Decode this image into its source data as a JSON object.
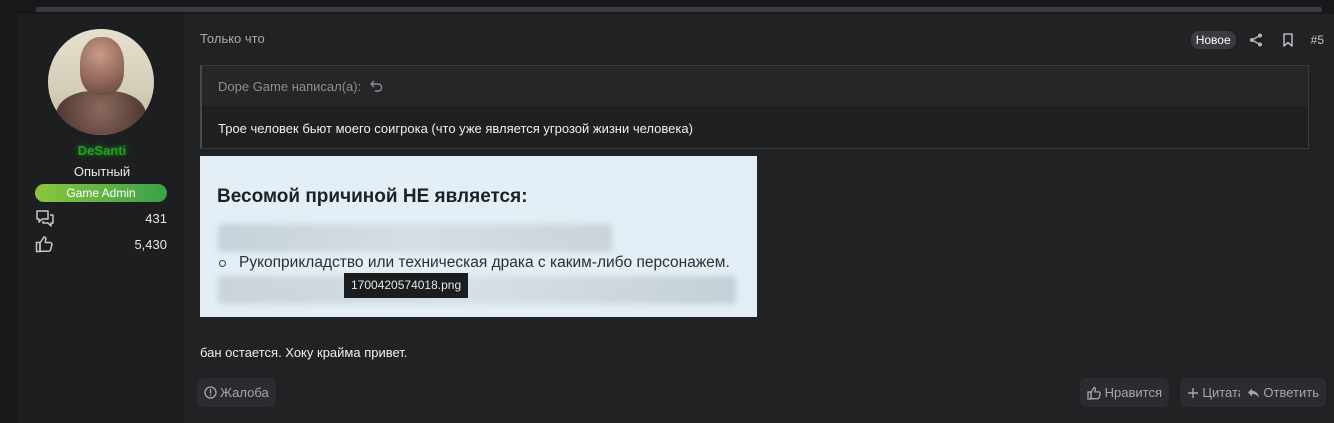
{
  "user": {
    "name": "DeSanti",
    "title": "Опытный",
    "banner": "Game Admin",
    "stats": [
      {
        "icon": "messages-icon",
        "value": "431"
      },
      {
        "icon": "reactions-thumbs-up-icon",
        "value": "5,430"
      }
    ]
  },
  "post": {
    "timestamp": "Только что",
    "new_badge": "Новое",
    "number": "#5",
    "quote": {
      "author": "Dope Game написал(а):",
      "text": "Трое человек бьют моего соигрока (что уже является угрозой жизни человека)"
    },
    "attachment": {
      "title": "Весомой причиной НЕ является:",
      "bullet": "Рукоприкладство или техническая драка с каким-либо персонажем.",
      "filename": "1700420574018.png"
    },
    "message": "бан остается. Хоку крайма привет."
  },
  "actions": {
    "report": "Жалоба",
    "like": "Нравится",
    "quote": "Цитата",
    "reply": "Ответить"
  },
  "colors": {
    "username": "#1fa31f",
    "banner_start": "#8bc53f",
    "banner_end": "#3aa14a",
    "background": "#212224"
  }
}
